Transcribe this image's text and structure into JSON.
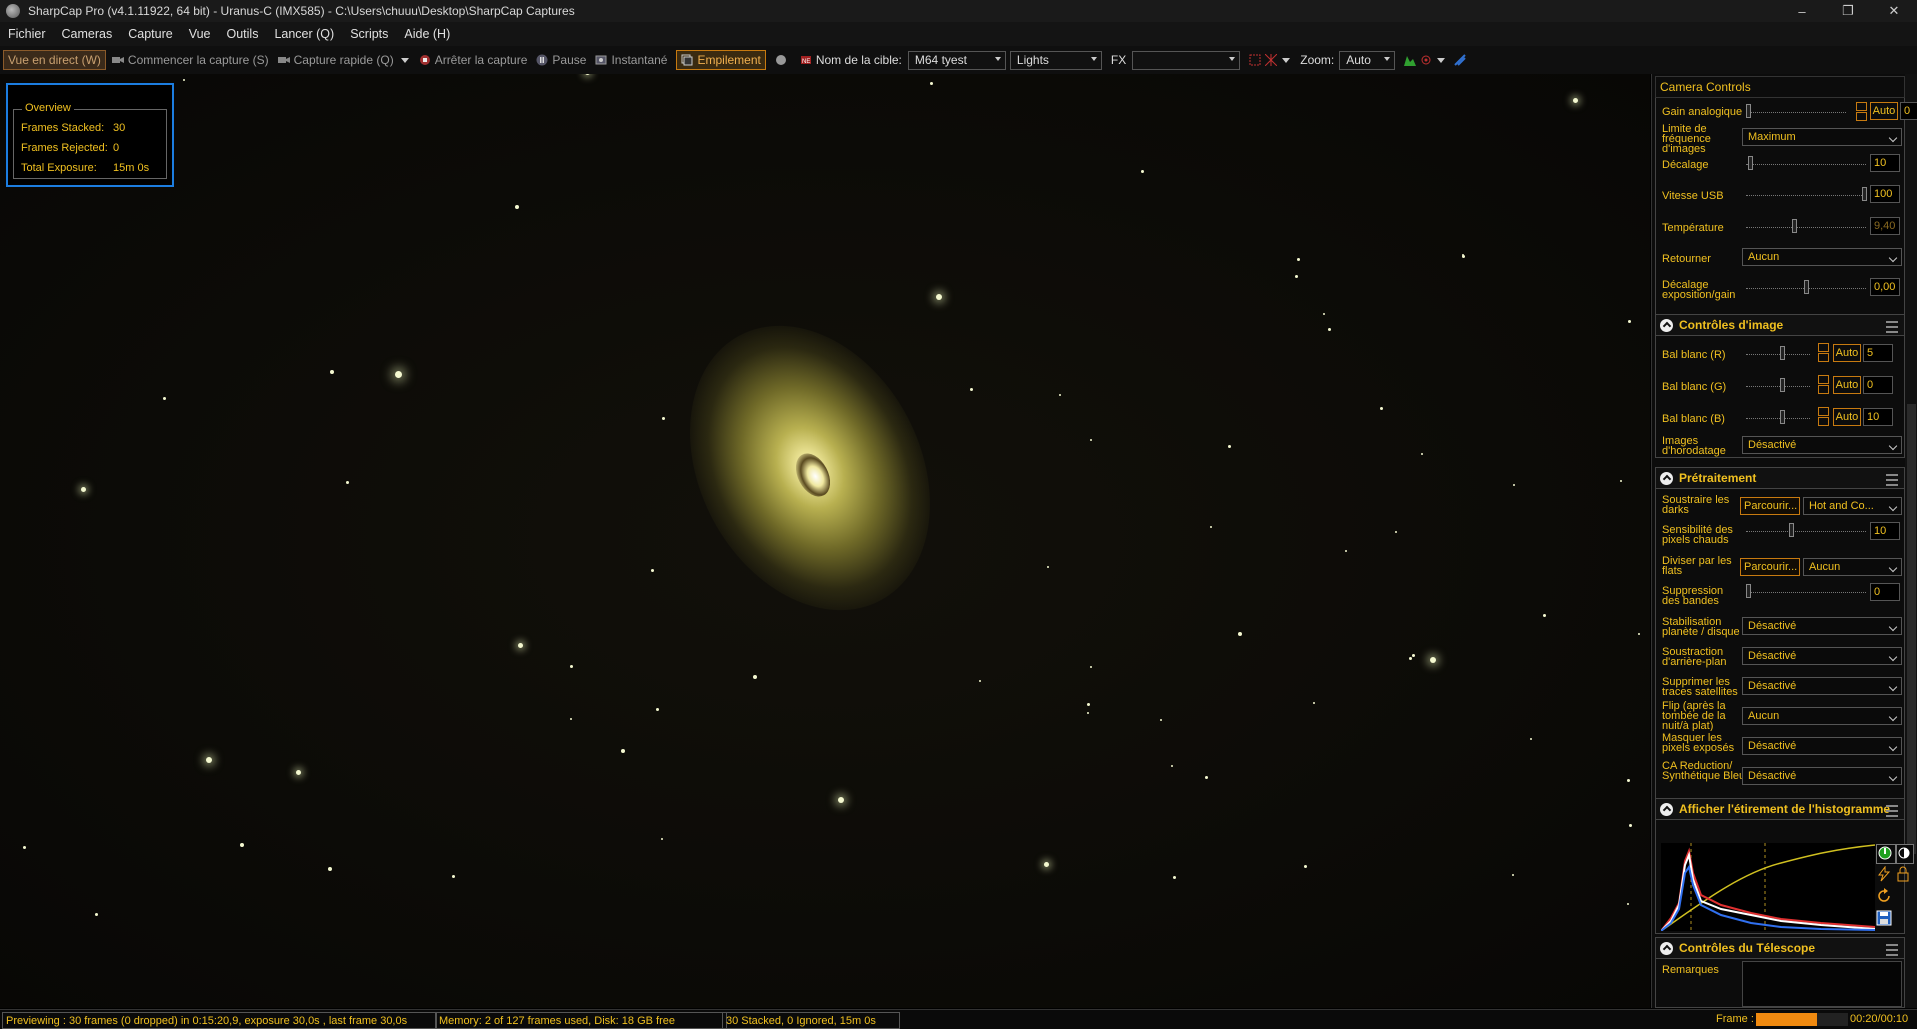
{
  "window": {
    "title": "SharpCap Pro (v4.1.11922, 64 bit) - Uranus-C (IMX585) - C:\\Users\\chuuu\\Desktop\\SharpCap Captures",
    "controls": [
      "–",
      "❐",
      "✕"
    ]
  },
  "menu": [
    "Fichier",
    "Cameras",
    "Capture",
    "Vue",
    "Outils",
    "Lancer (Q)",
    "Scripts",
    "Aide (H)"
  ],
  "toolbar": {
    "live_view": "Vue en direct (W)",
    "start_capture": "Commencer la capture (S)",
    "quick_capture": "Capture rapide (Q)",
    "stop_capture": "Arrêter la capture",
    "pause": "Pause",
    "snapshot": "Instantané",
    "stacking": "Empilement",
    "target_label": "Nom de la cible:",
    "target_value": "M64 tyest",
    "frame_type": "Lights",
    "fx_label": "FX",
    "fx_value": "",
    "zoom_label": "Zoom:",
    "zoom_value": "Auto"
  },
  "overview": {
    "title": "Overview",
    "frames_stacked_label": "Frames Stacked:",
    "frames_stacked": "30",
    "frames_rejected_label": "Frames Rejected:",
    "frames_rejected": "0",
    "total_exposure_label": "Total Exposure:",
    "total_exposure": "15m 0s"
  },
  "camera_controls": {
    "title": "Camera Controls",
    "gain_label": "Gain analogique",
    "gain_auto": "Auto",
    "gain_value": "0",
    "fps_label": "Limite de fréquence d'images",
    "fps_value": "Maximum",
    "offset_label": "Décalage",
    "offset_value": "10",
    "usb_label": "Vitesse USB",
    "usb_value": "100",
    "temp_label": "Température",
    "temp_value": "9,40",
    "flip_label": "Retourner",
    "flip_value": "Aucun",
    "expgain_label": "Décalage exposition/gain",
    "expgain_value": "0,00"
  },
  "image_controls": {
    "title": "Contrôles d'image",
    "wb_r_label": "Bal blanc (R)",
    "wb_r_value": "5",
    "wb_g_label": "Bal blanc (G)",
    "wb_g_value": "0",
    "wb_b_label": "Bal blanc (B)",
    "wb_b_value": "10",
    "auto": "Auto",
    "timestamp_label": "Images d'horodatage",
    "timestamp_value": "Désactivé"
  },
  "preprocessing": {
    "title": "Prétraitement",
    "darks_label": "Soustraire les darks",
    "darks_browse": "Parcourir...",
    "darks_value": "Hot and Co...",
    "hotpix_label": "Sensibilité des pixels chauds",
    "hotpix_value": "10",
    "flats_label": "Diviser par les flats",
    "flats_browse": "Parcourir...",
    "flats_value": "Aucun",
    "banding_label": "Suppression des bandes",
    "banding_value": "0",
    "stab_label": "Stabilisation planète / disque",
    "stab_value": "Désactivé",
    "bgsub_label": "Soustraction d'arrière-plan",
    "bgsub_value": "Désactivé",
    "sat_label": "Supprimer les traces satellites",
    "sat_value": "Désactivé",
    "flip2_label": "Flip (après la tombée de la nuit/à plat)",
    "flip2_value": "Aucun",
    "mask_label": "Masquer les pixels exposés",
    "mask_value": "Désactivé",
    "ca_label": "CA Reduction/ Synthétique Bleu",
    "ca_value": "Désactivé"
  },
  "histogram": {
    "title": "Afficher l'étirement de l'histogramme"
  },
  "telescope": {
    "title": "Contrôles du Télescope",
    "notes_label": "Remarques"
  },
  "status": {
    "preview": "Previewing : 30 frames (0 dropped) in 0:15:20,9, exposure 30,0s , last frame 30,0s",
    "memory": "Memory: 2 of 127 frames used, Disk: 18 GB free",
    "stacked": "30 Stacked, 0 Ignored, 15m 0s",
    "frame_label": "Frame :",
    "frame_time": "00:20/00:10",
    "frame_progress": 0.66
  }
}
